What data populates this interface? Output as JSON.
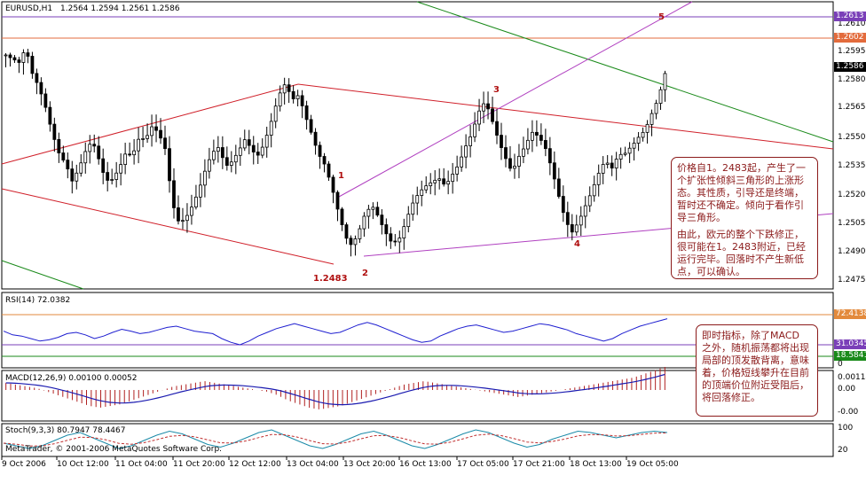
{
  "header": {
    "symbol": "EURUSD,H1",
    "ohlc": "1.2564 1.2594 1.2561 1.2586"
  },
  "price_axis": {
    "labels": [
      "1.2610",
      "1.2595",
      "1.2580",
      "1.2565",
      "1.2550",
      "1.2535",
      "1.2520",
      "1.2505",
      "1.2490",
      "1.2475"
    ]
  },
  "price_tags": {
    "top_line": "1.2613",
    "resistance": "1.2602",
    "current": "1.2586"
  },
  "wave_labels": {
    "w1": "1",
    "w2": "2",
    "w3": "3",
    "w4": "4",
    "w5": "5",
    "low": "1.2483"
  },
  "notes": {
    "main_p1": "价格自1。2483起，产生了一个扩张性倾斜三角形的上涨形态。其性质，引导还是终端，暂时还不确定。倾向于看作引导三角形。",
    "main_p2": "由此，欧元的整个下跌修正，很可能在1。2483附近，已经运行完毕。回落时不产生新低点，可以确认。",
    "indicator": "即时指标，除了MACD 之外，随机振荡都将出现局部的顶发散背离，意味着，价格短线攀升在目前的顶端价位附近受阻后，将回落修正。"
  },
  "rsi": {
    "title": "RSI(14) 72.0382",
    "tag_upper": "72.4138",
    "tag_mid": "31.0345",
    "tag_low": "18.5841",
    "axis_low": "0"
  },
  "macd": {
    "title": "MACD(12,26,9) 0.00100 0.00052",
    "axis_top": "0.00114",
    "axis_mid": "0.00",
    "axis_low": "-0.00"
  },
  "stoch": {
    "title": "Stoch(9,3,3) 80.7947 78.4467",
    "axis_top": "100",
    "axis_low": "20",
    "credit": "MetaTrader, © 2001-2006 MetaQuotes Software Corp."
  },
  "time_axis": {
    "labels": [
      "9 Oct 2006",
      "10 Oct 12:00",
      "11 Oct 04:00",
      "11 Oct 20:00",
      "12 Oct 12:00",
      "13 Oct 04:00",
      "13 Oct 20:00",
      "16 Oct 13:00",
      "17 Oct 05:00",
      "17 Oct 21:00",
      "18 Oct 13:00",
      "19 Oct 05:00"
    ]
  },
  "colors": {
    "bars": "#000000",
    "red_channel": "#d0202a",
    "magenta_channel": "#b040c0",
    "green_trend": "#1a8a1a",
    "rsi_line": "#1e1ed0",
    "macd_hist": "#b02020",
    "macd_signal": "#1a1ab0",
    "note_border": "#8b1a1a"
  },
  "chart_data": {
    "type": "candlestick",
    "symbol": "EURUSD",
    "timeframe": "H1",
    "x_ticks": [
      "9 Oct 2006",
      "10 Oct 12:00",
      "11 Oct 04:00",
      "11 Oct 20:00",
      "12 Oct 12:00",
      "13 Oct 04:00",
      "13 Oct 20:00",
      "16 Oct 13:00",
      "17 Oct 05:00",
      "17 Oct 21:00",
      "18 Oct 13:00",
      "19 Oct 05:00"
    ],
    "ylim": [
      1.2468,
      1.2618
    ],
    "key_levels": [
      1.2613,
      1.2602,
      1.2586
    ],
    "wave_points": [
      {
        "label": "1",
        "price": 1.2522
      },
      {
        "label": "2",
        "price": 1.2488
      },
      {
        "label": "3",
        "price": 1.2566
      },
      {
        "label": "4",
        "price": 1.2502
      },
      {
        "label": "5",
        "price": 1.2613
      }
    ],
    "swing_low": 1.2483,
    "close_path": [
      1.2598,
      1.2592,
      1.2588,
      1.2596,
      1.2584,
      1.258,
      1.2572,
      1.256,
      1.2548,
      1.254,
      1.2526,
      1.253,
      1.2538,
      1.2544,
      1.2536,
      1.2528,
      1.2532,
      1.254,
      1.2548,
      1.2544,
      1.255,
      1.2546,
      1.2552,
      1.2548,
      1.2542,
      1.2516,
      1.2508,
      1.2512,
      1.2518,
      1.2524,
      1.2532,
      1.2538,
      1.254,
      1.253,
      1.2536,
      1.2546,
      1.2556,
      1.255,
      1.2546,
      1.2552,
      1.256,
      1.257,
      1.2576,
      1.2568,
      1.2574,
      1.2566,
      1.2558,
      1.2548,
      1.254,
      1.2524,
      1.2506,
      1.249,
      1.2484,
      1.2494,
      1.2508,
      1.2516,
      1.2512,
      1.2504,
      1.2496,
      1.2494,
      1.25,
      1.2508,
      1.2514,
      1.252,
      1.2526,
      1.2532,
      1.253,
      1.2536,
      1.254,
      1.2546,
      1.255,
      1.256,
      1.2566,
      1.2558,
      1.255,
      1.2544,
      1.2538,
      1.2546,
      1.255,
      1.2554,
      1.2548,
      1.254,
      1.2528,
      1.2516,
      1.2506,
      1.2502,
      1.251,
      1.2518,
      1.2524,
      1.253,
      1.2534,
      1.2528,
      1.2536,
      1.254,
      1.2548,
      1.2556,
      1.2562,
      1.257,
      1.2576,
      1.2586
    ],
    "rsi_path": [
      52,
      46,
      44,
      40,
      36,
      38,
      42,
      48,
      50,
      46,
      40,
      44,
      50,
      55,
      52,
      48,
      50,
      54,
      58,
      60,
      56,
      52,
      50,
      48,
      40,
      34,
      30,
      36,
      44,
      50,
      56,
      60,
      64,
      60,
      56,
      52,
      48,
      50,
      56,
      62,
      66,
      62,
      56,
      50,
      44,
      38,
      34,
      36,
      44,
      50,
      56,
      60,
      62,
      58,
      54,
      50,
      52,
      56,
      60,
      64,
      62,
      58,
      54,
      48,
      44,
      40,
      36,
      40,
      48,
      54,
      60,
      64,
      68,
      72
    ],
    "macd_hist": [
      8,
      6,
      4,
      2,
      -2,
      -6,
      -10,
      -14,
      -18,
      -20,
      -18,
      -16,
      -12,
      -8,
      -4,
      0,
      4,
      6,
      8,
      10,
      8,
      6,
      4,
      2,
      0,
      -2,
      -6,
      -12,
      -16,
      -20,
      -22,
      -20,
      -18,
      -14,
      -10,
      -6,
      -2,
      2,
      6,
      8,
      10,
      8,
      6,
      4,
      2,
      0,
      -2,
      -4,
      -6,
      -8,
      -6,
      -4,
      -2,
      0,
      2,
      4,
      6,
      8,
      10,
      12,
      14,
      18,
      22,
      26
    ],
    "stoch_path": [
      40,
      30,
      20,
      30,
      50,
      70,
      80,
      60,
      40,
      20,
      30,
      50,
      70,
      85,
      75,
      55,
      35,
      25,
      40,
      60,
      80,
      90,
      70,
      50,
      30,
      20,
      35,
      55,
      75,
      85,
      70,
      50,
      30,
      20,
      35,
      55,
      75,
      90,
      80,
      60,
      40,
      25,
      35,
      55,
      70,
      85,
      80,
      70,
      60,
      70,
      80,
      85,
      80
    ]
  }
}
